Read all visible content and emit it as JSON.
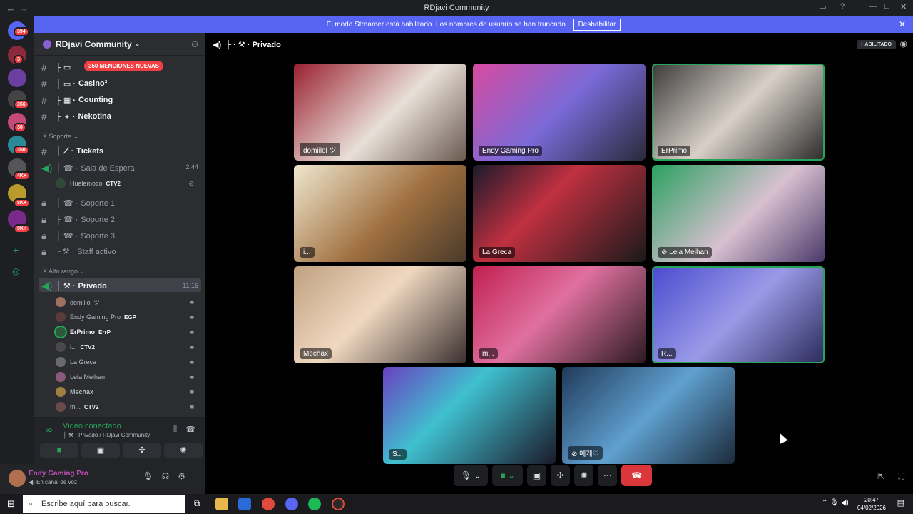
{
  "titlebar": {
    "title": "RDjavi Community"
  },
  "banner": {
    "text": "El modo Streamer está habilitado. Los nombres de usuario se han truncado.",
    "button": "Deshabilitar"
  },
  "rail": {
    "badges": [
      "394",
      "3",
      "356",
      "30",
      "350",
      "4K+",
      "8K+",
      "9K+"
    ]
  },
  "sidebar": {
    "guild_name": "RDjavi Community",
    "mention_badge": "350 MENCIONES NUEVAS",
    "channels_top": [
      {
        "icon": "#",
        "name": "Casino³"
      },
      {
        "icon": "#",
        "name": "Counting"
      },
      {
        "icon": "#",
        "name": "Nekotina"
      }
    ],
    "cat_support": "Soporte",
    "tickets": "Tickets",
    "sala": {
      "name": "Sala de Espera",
      "time": "2:44"
    },
    "sala_user": {
      "name": "Huelemoco",
      "tag": "CTV2"
    },
    "soporte": [
      "Soporte 1",
      "Soporte 2",
      "Soporte 3",
      "Staff activo"
    ],
    "cat_alto": "Alto rango",
    "privado": {
      "name": "Privado",
      "time": "11:16"
    },
    "users": [
      {
        "name": "domiilol ツ",
        "tag": ""
      },
      {
        "name": "Endy Gaming Pro",
        "tag": "EGP"
      },
      {
        "name": "ErPrimo",
        "tag": "ErrP"
      },
      {
        "name": "i...",
        "tag": "CTV2"
      },
      {
        "name": "La Greca",
        "tag": ""
      },
      {
        "name": "Lela Meihan",
        "tag": ""
      },
      {
        "name": "Mechax",
        "tag": ""
      },
      {
        "name": "m...",
        "tag": "CTV2"
      }
    ]
  },
  "voice": {
    "title": "Video conectado",
    "sub": "Privado / RDjavi Community"
  },
  "panel": {
    "name": "Endy Gaming Pro",
    "status": "En canal de voz"
  },
  "stage": {
    "channel": "Privado",
    "status": "HABILITADO",
    "tiles": [
      {
        "label": "domiilol ツ"
      },
      {
        "label": "Endy Gaming Pro"
      },
      {
        "label": "ErPrimo"
      },
      {
        "label": "i..."
      },
      {
        "label": "La Greca"
      },
      {
        "label": "Lela Meihan"
      },
      {
        "label": "Mechax"
      },
      {
        "label": "m..."
      },
      {
        "label": "R..."
      },
      {
        "label": "S..."
      },
      {
        "label": "예게♡"
      }
    ]
  },
  "taskbar": {
    "search_placeholder": "Escribe aquí para buscar.",
    "time": "20:47",
    "date": "04/02/2026"
  }
}
